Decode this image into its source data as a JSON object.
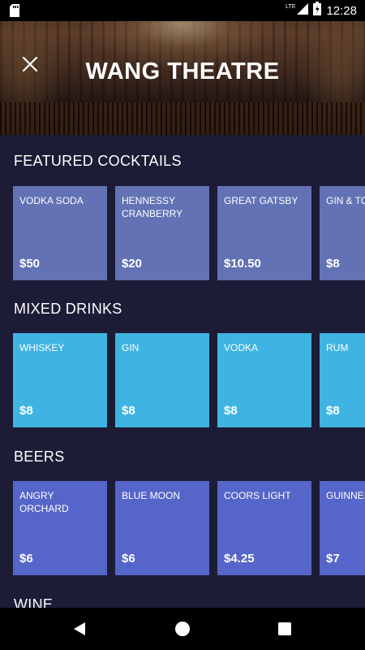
{
  "status_bar": {
    "time": "12:28",
    "network": "LTE"
  },
  "header": {
    "title": "WANG THEATRE"
  },
  "sections": [
    {
      "title": "FEATURED COCKTAILS",
      "items": [
        {
          "name": "VODKA SODA",
          "price": "$50"
        },
        {
          "name": "HENNESSY CRANBERRY",
          "price": "$20"
        },
        {
          "name": "GREAT GATSBY",
          "price": "$10.50"
        },
        {
          "name": "GIN & TONIC",
          "price": "$8"
        }
      ]
    },
    {
      "title": "MIXED DRINKS",
      "items": [
        {
          "name": "WHISKEY",
          "price": "$8"
        },
        {
          "name": "GIN",
          "price": "$8"
        },
        {
          "name": "VODKA",
          "price": "$8"
        },
        {
          "name": "RUM",
          "price": "$8"
        }
      ]
    },
    {
      "title": "BEERS",
      "items": [
        {
          "name": "ANGRY ORCHARD",
          "price": "$6"
        },
        {
          "name": "BLUE MOON",
          "price": "$6"
        },
        {
          "name": "COORS LIGHT",
          "price": "$4.25"
        },
        {
          "name": "GUINNESS",
          "price": "$7"
        }
      ]
    },
    {
      "title": "WINE",
      "items": []
    }
  ],
  "colors": {
    "background": "#1c1c36",
    "cocktail_card": "#6272b4",
    "mixed_card": "#3fb4e2",
    "beer_card": "#5665c9"
  }
}
